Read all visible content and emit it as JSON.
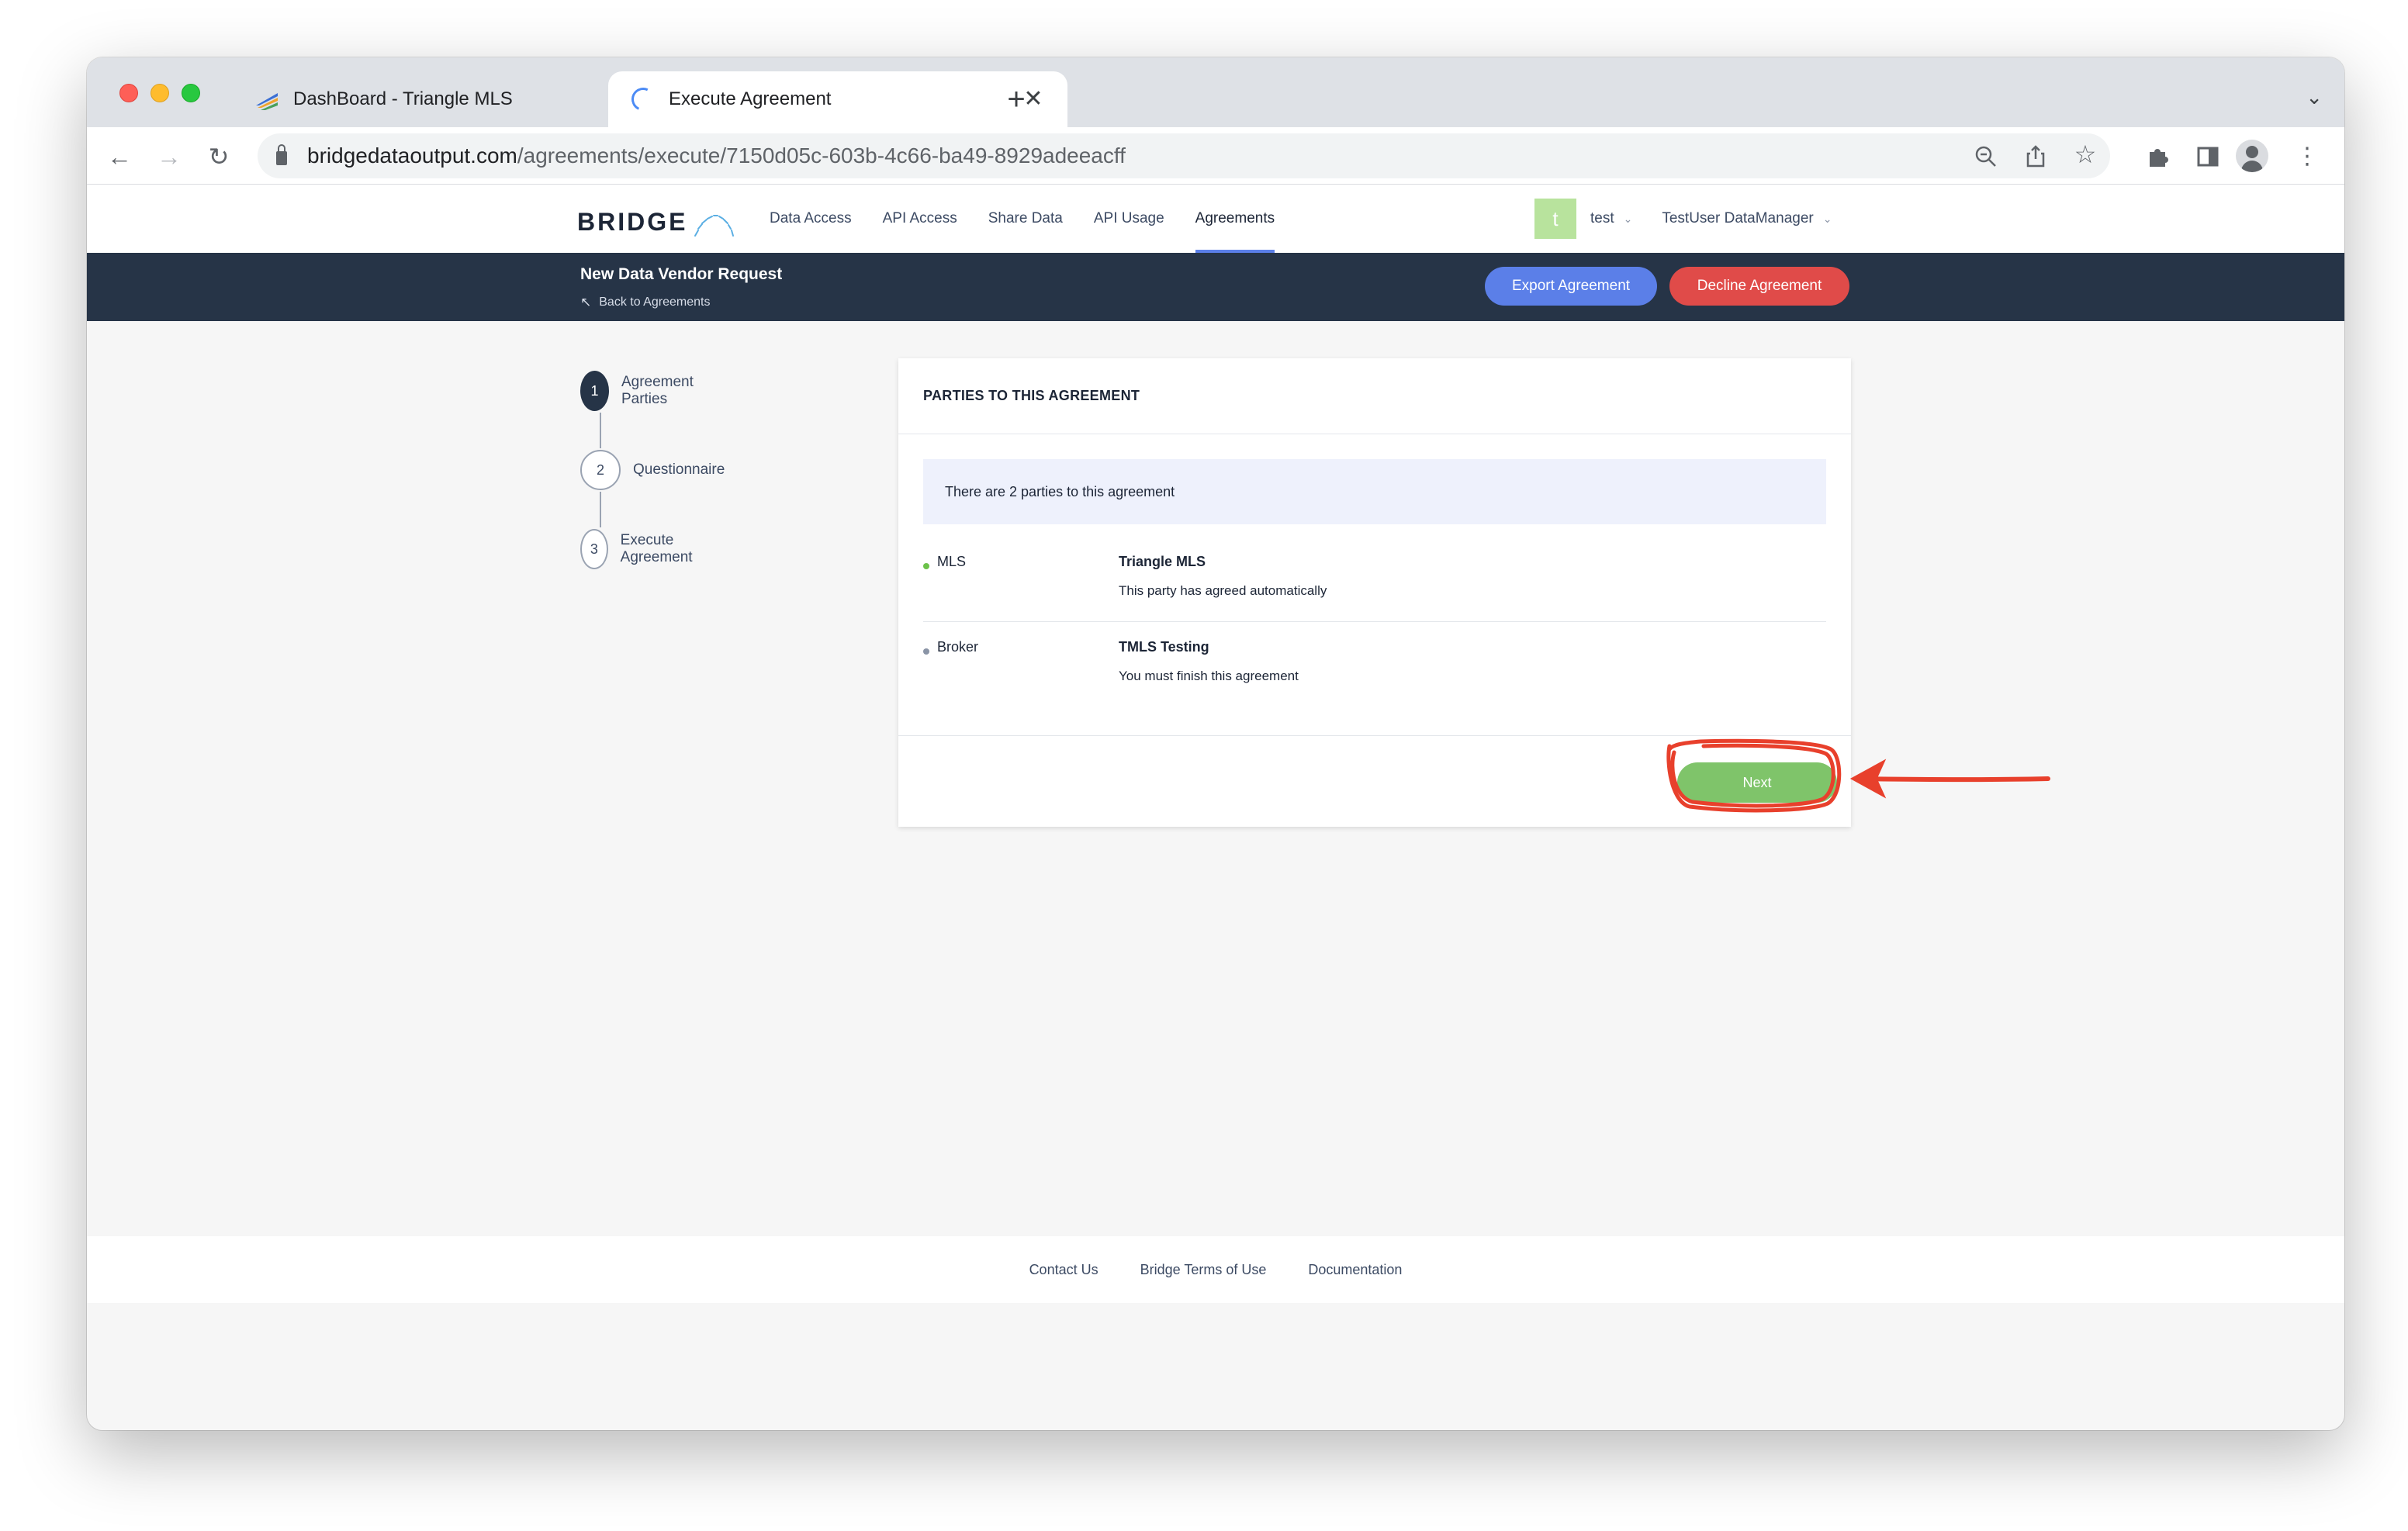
{
  "browser": {
    "tabs": [
      {
        "title": "DashBoard - Triangle MLS",
        "close": "✕"
      },
      {
        "title": "Execute Agreement",
        "close": "✕"
      }
    ],
    "new_tab": "+",
    "url_host": "bridgedataoutput.com",
    "url_path": "/agreements/execute/7150d05c-603b-4c66-ba49-8929adeeacff"
  },
  "header": {
    "logo": "BRIDGE",
    "nav": [
      "Data Access",
      "API Access",
      "Share Data",
      "API Usage",
      "Agreements"
    ],
    "active_nav": "Agreements",
    "avatar_letter": "t",
    "user_short": "test",
    "user_full": "TestUser DataManager"
  },
  "banner": {
    "title": "New Data Vendor Request",
    "back_label": "Back to Agreements",
    "export_label": "Export Agreement",
    "decline_label": "Decline Agreement"
  },
  "steps": [
    {
      "number": "1",
      "label": "Agreement Parties",
      "active": true
    },
    {
      "number": "2",
      "label": "Questionnaire",
      "active": false
    },
    {
      "number": "3",
      "label": "Execute Agreement",
      "active": false
    }
  ],
  "card": {
    "header": "PARTIES TO THIS AGREEMENT",
    "info": "There are 2 parties to this agreement",
    "parties": [
      {
        "role": "MLS",
        "name": "Triangle MLS",
        "status": "This party has agreed automatically",
        "dot_color": "#6cc24a"
      },
      {
        "role": "Broker",
        "name": "TMLS Testing",
        "status": "You must finish this agreement",
        "dot_color": "#8a94a6"
      }
    ],
    "next_label": "Next"
  },
  "footer": {
    "links": [
      "Contact Us",
      "Bridge Terms of Use",
      "Documentation"
    ]
  },
  "colors": {
    "banner_bg": "#263447",
    "export_btn": "#5b7fe8",
    "decline_btn": "#e04b49",
    "next_btn": "#7fc46a",
    "annotation": "#e8402c"
  }
}
